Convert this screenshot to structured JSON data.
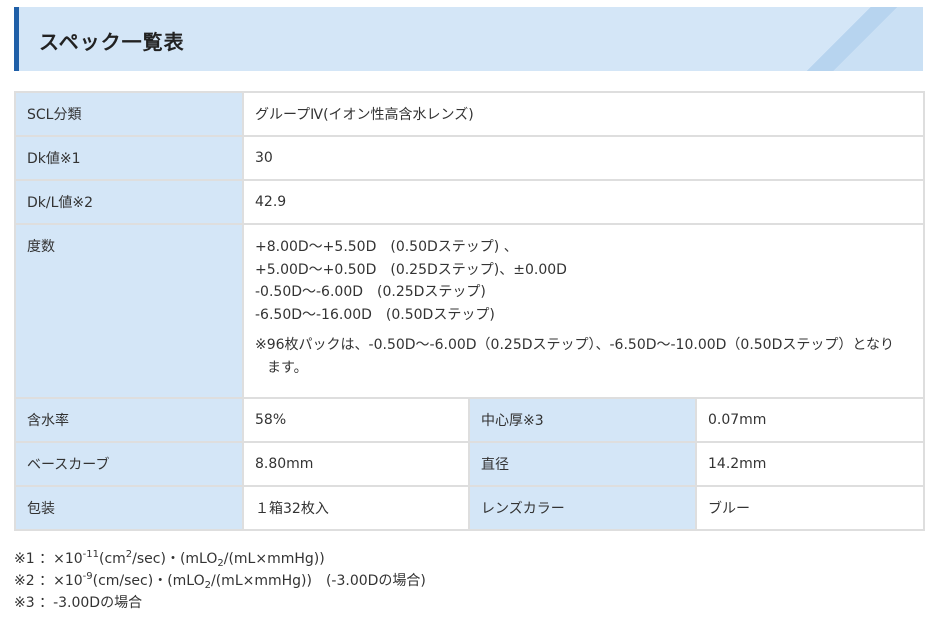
{
  "header": {
    "title": "スペック一覧表"
  },
  "spec": {
    "scl_label": "SCL分類",
    "scl_value": "グループⅣ(イオン性高含水レンズ)",
    "dk_label": "Dk値※1",
    "dk_value": "30",
    "dkl_label": "Dk/L値※2",
    "dkl_value": "42.9",
    "power_label": "度数",
    "power_lines": [
      "+8.00D～+5.50D　(0.50Dステップ) 、",
      "+5.00D～+0.50D　(0.25Dステップ)、±0.00D",
      "-0.50D～-6.00D　(0.25Dステップ)",
      "-6.50D～-16.00D　(0.50Dステップ)"
    ],
    "power_note": "※96枚パックは、-0.50D～-6.00D（0.25Dステップ）、-6.50D～-10.00D（0.50Dステップ）となり",
    "power_note_cont": "ます。",
    "water_label": "含水率",
    "water_value": "58%",
    "center_label": "中心厚※3",
    "center_value": "0.07mm",
    "bc_label": "ベースカーブ",
    "bc_value": "8.80mm",
    "diameter_label": "直径",
    "diameter_value": "14.2mm",
    "package_label": "包装",
    "package_value": "１箱32枚入",
    "color_label": "レンズカラー",
    "color_value": "ブルー"
  },
  "notes": {
    "n1_prefix": "※1 ：×10",
    "n1_exp": "-11",
    "n1_mid": "(cm",
    "n1_sq": "2",
    "n1_mid2": "/sec)・(mLO",
    "n1_o2": "2",
    "n1_end": "/(mL×mmHg))",
    "n2_prefix": "※2 ：×10",
    "n2_exp": "-9",
    "n2_mid": "(cm/sec)・(mLO",
    "n2_o2": "2",
    "n2_end": "/(mL×mmHg))　(-3.00Dの場合)",
    "n3": "※3 ：-3.00Dの場合"
  },
  "colors": {
    "header_bg": "#d4e6f7",
    "accent": "#1f5fa8",
    "label_bg": "#d4e6f7",
    "border": "#dedede"
  }
}
